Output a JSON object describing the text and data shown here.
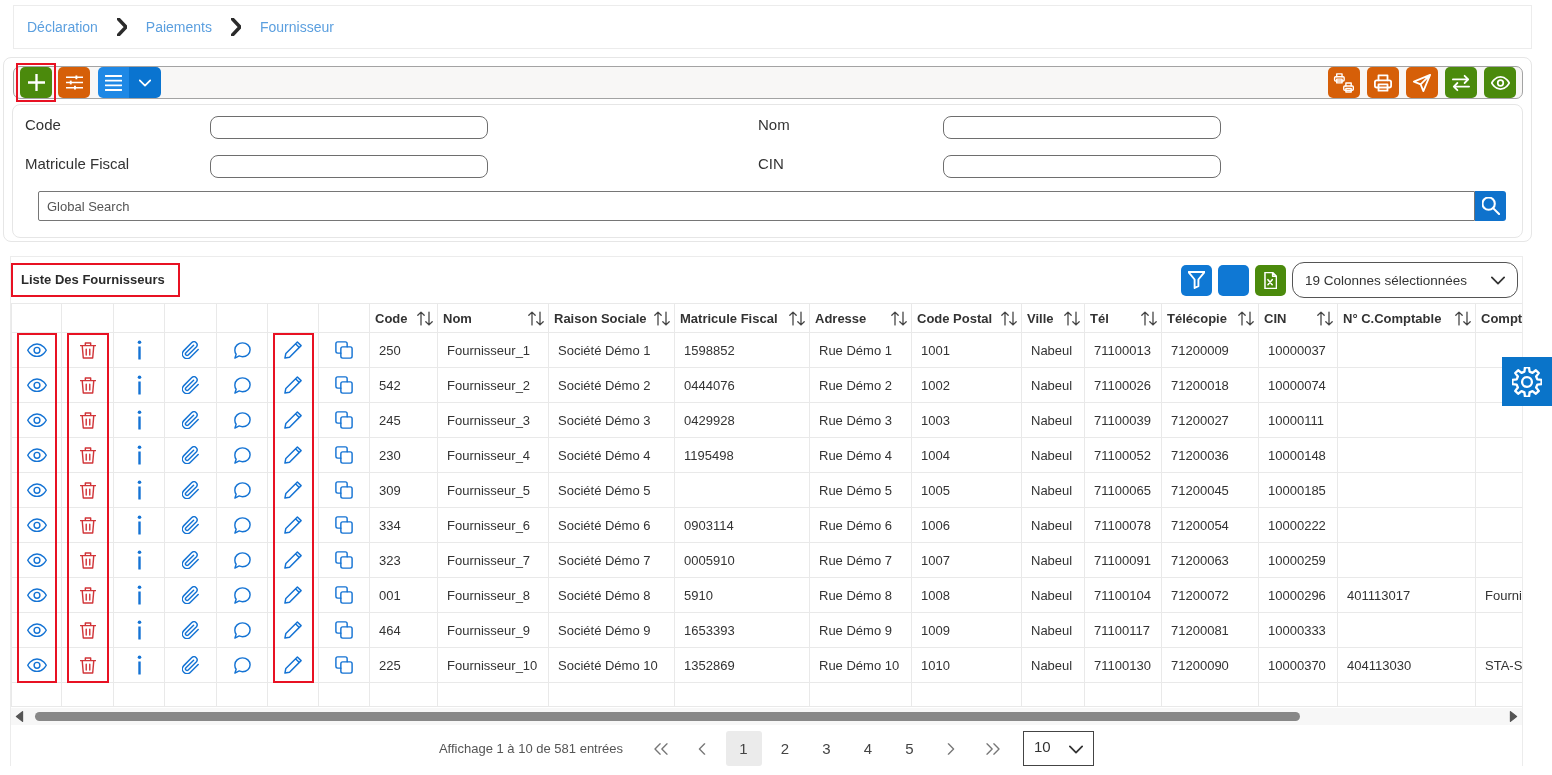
{
  "breadcrumb": [
    {
      "label": "Déclaration"
    },
    {
      "label": "Paiements"
    },
    {
      "label": "Fournisseur"
    }
  ],
  "toolbar": {
    "left": [
      {
        "kind": "add",
        "color": "#4b8a0c",
        "highlighted": true
      },
      {
        "kind": "adjust",
        "color": "#d65f08",
        "highlighted": false
      },
      {
        "kind": "list-menu",
        "color": "#1e88e5",
        "highlighted": false
      }
    ],
    "right": [
      {
        "kind": "print-batch",
        "color": "#d65f08",
        "highlighted": false
      },
      {
        "kind": "print",
        "color": "#d65f08",
        "highlighted": false
      },
      {
        "kind": "send",
        "color": "#d65f08",
        "highlighted": false
      },
      {
        "kind": "swap",
        "color": "#4b8a0c",
        "highlighted": false
      },
      {
        "kind": "view",
        "color": "#4b8a0c",
        "highlighted": false
      }
    ]
  },
  "filters": [
    {
      "label": "Code"
    },
    {
      "label": "Nom"
    },
    {
      "label": "Matricule Fiscal"
    },
    {
      "label": "CIN"
    }
  ],
  "global_search": {
    "placeholder": "Global Search"
  },
  "list": {
    "title": "Liste Des Fournisseurs",
    "title_highlighted": true,
    "tools": [
      {
        "kind": "filter",
        "color": "#0f78d4"
      },
      {
        "kind": "blank",
        "color": "#0f78d4"
      },
      {
        "kind": "excel",
        "color": "#4b8a0c"
      }
    ],
    "columns_select": "19 Colonnes sélectionnées"
  },
  "table": {
    "action_columns": [
      {
        "kind": "view",
        "highlighted": true
      },
      {
        "kind": "delete",
        "highlighted": true
      },
      {
        "kind": "info",
        "highlighted": false
      },
      {
        "kind": "attach",
        "highlighted": false
      },
      {
        "kind": "comment",
        "highlighted": false
      },
      {
        "kind": "edit",
        "highlighted": true
      },
      {
        "kind": "duplicate",
        "highlighted": false
      }
    ],
    "columns": [
      "Code",
      "Nom",
      "Raison Sociale",
      "Matricule Fiscal",
      "Adresse",
      "Code Postal",
      "Ville",
      "Tél",
      "Télécopie",
      "CIN",
      "N° C.Comptable",
      "Compt"
    ],
    "rows": [
      [
        "250",
        "Fournisseur_1",
        "Société Démo 1",
        "1598852",
        "Rue Démo 1",
        "1001",
        "Nabeul",
        "71100013",
        "71200009",
        "10000037",
        null,
        null
      ],
      [
        "542",
        "Fournisseur_2",
        "Société Démo 2",
        "0444076",
        "Rue Démo 2",
        "1002",
        "Nabeul",
        "71100026",
        "71200018",
        "10000074",
        null,
        null
      ],
      [
        "245",
        "Fournisseur_3",
        "Société Démo 3",
        "0429928",
        "Rue Démo 3",
        "1003",
        "Nabeul",
        "71100039",
        "71200027",
        "10000111",
        null,
        null
      ],
      [
        "230",
        "Fournisseur_4",
        "Société Démo 4",
        "1195498",
        "Rue Démo 4",
        "1004",
        "Nabeul",
        "71100052",
        "71200036",
        "10000148",
        null,
        null
      ],
      [
        "309",
        "Fournisseur_5",
        "Société Démo 5",
        null,
        "Rue Démo 5",
        "1005",
        "Nabeul",
        "71100065",
        "71200045",
        "10000185",
        null,
        null
      ],
      [
        "334",
        "Fournisseur_6",
        "Société Démo 6",
        "0903114",
        "Rue Démo 6",
        "1006",
        "Nabeul",
        "71100078",
        "71200054",
        "10000222",
        null,
        null
      ],
      [
        "323",
        "Fournisseur_7",
        "Société Démo 7",
        "0005910",
        "Rue Démo 7",
        "1007",
        "Nabeul",
        "71100091",
        "71200063",
        "10000259",
        null,
        null
      ],
      [
        "001",
        "Fournisseur_8",
        "Société Démo 8",
        "5910",
        "Rue Démo 8",
        "1008",
        "Nabeul",
        "71100104",
        "71200072",
        "10000296",
        "401113017",
        "Fourni"
      ],
      [
        "464",
        "Fournisseur_9",
        "Société Démo 9",
        "1653393",
        "Rue Démo 9",
        "1009",
        "Nabeul",
        "71100117",
        "71200081",
        "10000333",
        null,
        null
      ],
      [
        "225",
        "Fournisseur_10",
        "Société Démo 10",
        "1352869",
        "Rue Démo 10",
        "1010",
        "Nabeul",
        "71100130",
        "71200090",
        "10000370",
        "404113030",
        "STA-S"
      ]
    ]
  },
  "pagination": {
    "summary": "Affichage 1 à 10 de 581 entrées",
    "pages": [
      {
        "label": "1",
        "selected": true
      },
      {
        "label": "2",
        "selected": false
      },
      {
        "label": "3",
        "selected": false
      },
      {
        "label": "4",
        "selected": false
      },
      {
        "label": "5",
        "selected": false
      }
    ],
    "page_size": "10"
  }
}
